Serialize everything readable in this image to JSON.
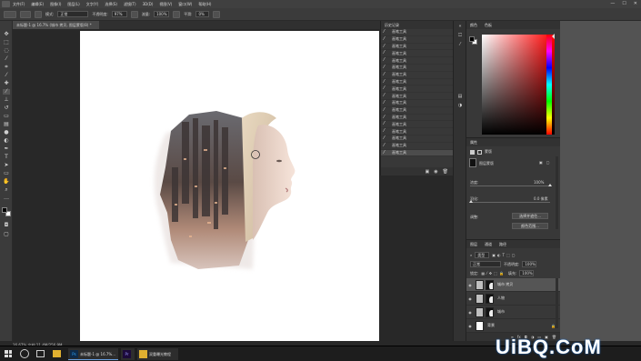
{
  "menubar": {
    "items": [
      "文件(F)",
      "编辑(E)",
      "图像(I)",
      "图层(L)",
      "文字(Y)",
      "选择(S)",
      "滤镜(T)",
      "3D(D)",
      "视图(V)",
      "窗口(W)",
      "帮助(H)"
    ],
    "window_controls": [
      "—",
      "☐",
      "✕"
    ]
  },
  "options": {
    "mode_label": "模式:",
    "mode_value": "正常",
    "opacity_label": "不透明度:",
    "opacity_value": "97%",
    "flow_label": "流量:",
    "flow_value": "100%",
    "smoothing_label": "平滑:",
    "smoothing_value": "0%"
  },
  "document": {
    "tab_title": "未标题-1 @ 16.7% (城市 拷贝, 图层蒙版/8) *",
    "zoom_status": "16.67%   文档:11.4M/256.9M"
  },
  "history": {
    "tab_label": "历史记录",
    "item_label": "画笔工具",
    "items": [
      "画笔工具",
      "画笔工具",
      "画笔工具",
      "画笔工具",
      "画笔工具",
      "画笔工具",
      "画笔工具",
      "画笔工具",
      "画笔工具",
      "画笔工具",
      "画笔工具",
      "画笔工具",
      "画笔工具",
      "画笔工具",
      "画笔工具",
      "画笔工具",
      "画笔工具",
      "画笔工具"
    ]
  },
  "color": {
    "tab_color": "颜色",
    "tab_swatches": "色板"
  },
  "properties": {
    "tab_label": "属性",
    "mask_label": "蒙版",
    "layer_mask_label": "图层蒙版",
    "density_label": "浓度:",
    "density_value": "100%",
    "feather_label": "羽化:",
    "feather_value": "0.0 像素",
    "adjust_label": "调整:",
    "select_mask_button": "选择并遮住...",
    "color_range_button": "颜色范围..."
  },
  "layers": {
    "tabs": [
      "图层",
      "通道",
      "路径"
    ],
    "kind_label": "类型",
    "blend_value": "正常",
    "opacity_label": "不透明度:",
    "opacity_value": "100%",
    "lock_label": "锁定:",
    "fill_label": "填充:",
    "fill_value": "100%",
    "rows": [
      {
        "name": "城市 拷贝",
        "selected": true,
        "mask": true
      },
      {
        "name": "人物",
        "selected": false,
        "mask": true
      },
      {
        "name": "城市",
        "selected": false,
        "mask": true
      },
      {
        "name": "背景",
        "selected": false,
        "mask": false
      }
    ]
  },
  "taskbar": {
    "apps": [
      {
        "icon": "Ps",
        "label": "未标题-1 @ 16.7%..."
      },
      {
        "icon": "Pr",
        "label": ""
      },
      {
        "icon": "",
        "label": "双重曝光教程"
      }
    ]
  },
  "watermark": "UiBQ.CoM"
}
